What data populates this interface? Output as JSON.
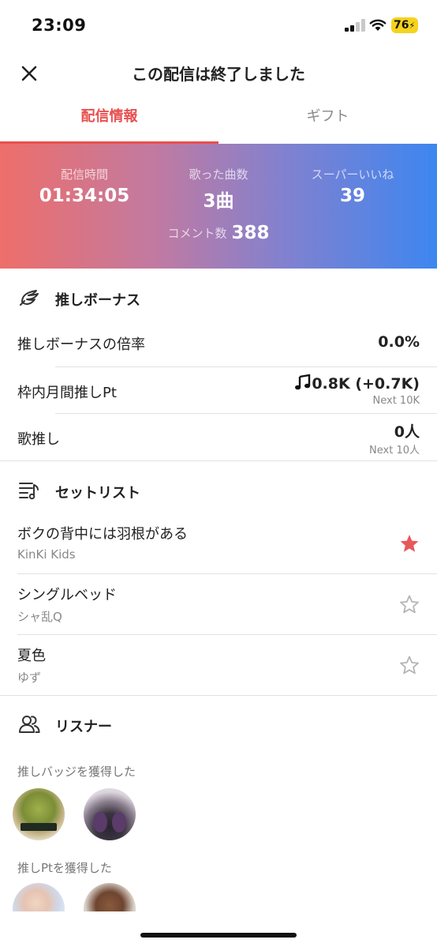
{
  "status_bar": {
    "time": "23:09",
    "battery": "76"
  },
  "header": {
    "title": "この配信は終了しました"
  },
  "tabs": [
    {
      "label": "配信情報"
    },
    {
      "label": "ギフト"
    }
  ],
  "stats": {
    "duration_label": "配信時間",
    "duration_value": "01:34:05",
    "songs_label": "歌った曲数",
    "songs_value": "3曲",
    "likes_label": "スーパーいいね",
    "likes_value": "39",
    "comments_label": "コメント数",
    "comments_value": "388"
  },
  "bonus": {
    "title": "推しボーナス",
    "rows": [
      {
        "label": "推しボーナスの倍率",
        "value": "0.0%"
      },
      {
        "label": "枠内月間推しPt",
        "value": "0.8K (+0.7K)",
        "sub": "Next 10K"
      },
      {
        "label": "歌推し",
        "value": "0人",
        "sub": "Next 10人"
      }
    ]
  },
  "setlist": {
    "title": "セットリスト",
    "songs": [
      {
        "title": "ボクの背中には羽根がある",
        "artist": "KinKi Kids",
        "starred": true
      },
      {
        "title": "シングルベッド",
        "artist": "シャ乱Q",
        "starred": false
      },
      {
        "title": "夏色",
        "artist": "ゆず",
        "starred": false
      }
    ]
  },
  "listeners": {
    "title": "リスナー",
    "badge_heading": "推しバッジを獲得した",
    "pt_heading": "推しPtを獲得した"
  },
  "colors": {
    "accent": "#e8504f",
    "gradient_start": "#ee6e6a",
    "gradient_end": "#3d86f0",
    "star_active": "#e8585a",
    "star_inactive": "#b5b5b5"
  }
}
